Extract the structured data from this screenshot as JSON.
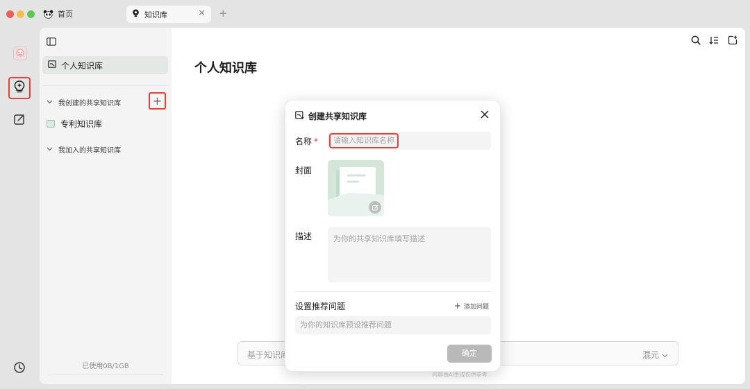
{
  "titlebar": {
    "traffic_lights": [
      "#ed5f57",
      "#f5be4f",
      "#61c554"
    ],
    "tabs": [
      {
        "label": "首页",
        "icon": "panda-icon",
        "active": false
      },
      {
        "label": "知识库",
        "icon": "bulb-icon",
        "active": true
      }
    ]
  },
  "rail": {
    "items": [
      {
        "name": "avatar",
        "icon": "avatar"
      },
      {
        "name": "knowledge",
        "icon": "bulb-icon",
        "highlighted": true
      },
      {
        "name": "write",
        "icon": "edit-icon"
      },
      {
        "name": "history",
        "icon": "clock-icon"
      }
    ]
  },
  "sidebar": {
    "personal_label": "个人知识库",
    "created_section": "我创建的共享知识库",
    "created_items": [
      {
        "label": "专利知识库"
      }
    ],
    "joined_section": "我加入的共享知识库",
    "usage": "已使用0B/1GB"
  },
  "main": {
    "title": "个人知识库",
    "toolbar_icons": [
      "search-icon",
      "sort-icon",
      "add-file-icon"
    ],
    "chat_placeholder": "基于知识库",
    "model_label": "混元",
    "disclaimer": "内容由AI生成仅供参考"
  },
  "dialog": {
    "title": "创建共享知识库",
    "name_label": "名称",
    "required_mark": "*",
    "name_placeholder": "请输入知识库名称",
    "cover_label": "封面",
    "desc_label": "描述",
    "desc_placeholder": "为你的共享知识库填写描述",
    "questions_label": "设置推荐问题",
    "add_question": "添加问题",
    "question_placeholder": "为你的知识库预设推荐问题",
    "confirm": "确定"
  },
  "colors": {
    "accent_green": "#d3e6d9",
    "highlight_red": "#e3423a",
    "disabled_button": "#b9b9b9"
  }
}
